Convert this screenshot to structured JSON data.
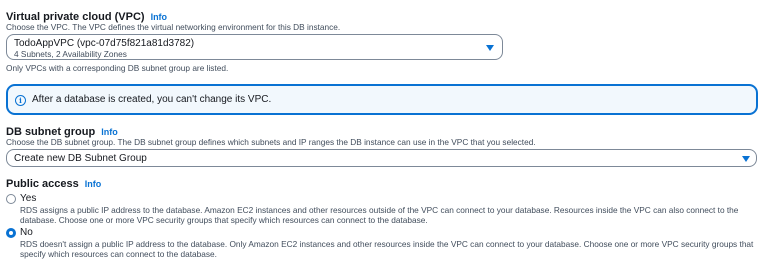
{
  "vpc": {
    "label": "Virtual private cloud (VPC)",
    "info": "Info",
    "description": "Choose the VPC. The VPC defines the virtual networking environment for this DB instance.",
    "selected_value": "TodoAppVPC (vpc-07d75f821a81d3782)",
    "selected_detail": "4 Subnets, 2 Availability Zones",
    "hint": "Only VPCs with a corresponding DB subnet group are listed."
  },
  "alert": {
    "icon": "info-circle-icon",
    "text": "After a database is created, you can't change its VPC."
  },
  "subnet_group": {
    "label": "DB subnet group",
    "info": "Info",
    "description": "Choose the DB subnet group. The DB subnet group defines which subnets and IP ranges the DB instance can use in the VPC that you selected.",
    "selected_value": "Create new DB Subnet Group"
  },
  "public_access": {
    "label": "Public access",
    "info": "Info",
    "options": [
      {
        "label": "Yes",
        "checked": false,
        "description": "RDS assigns a public IP address to the database. Amazon EC2 instances and other resources outside of the VPC can connect to your database. Resources inside the VPC can also connect to the database. Choose one or more VPC security groups that specify which resources can connect to the database."
      },
      {
        "label": "No",
        "checked": true,
        "description": "RDS doesn't assign a public IP address to the database. Only Amazon EC2 instances and other resources inside the VPC can connect to your database. Choose one or more VPC security groups that specify which resources can connect to the database."
      }
    ]
  },
  "colors": {
    "accent": "#0972d3",
    "alert_background": "#f2f8fd",
    "text": "#16191f",
    "secondary_text": "#414d5c",
    "border": "#7d8998"
  }
}
